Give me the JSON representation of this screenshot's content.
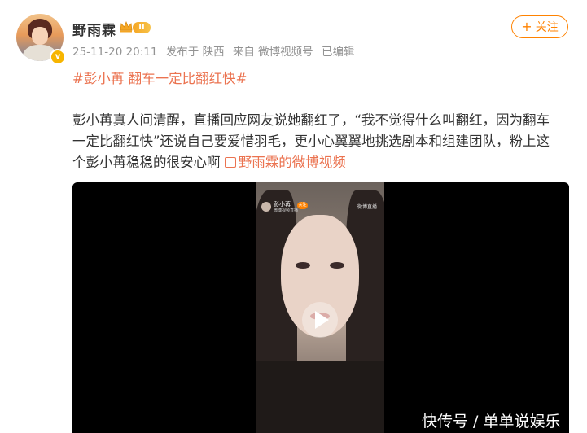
{
  "user": {
    "name": "野雨霖",
    "level_badge": "II",
    "verified_icon": "v-icon"
  },
  "meta": {
    "timestamp": "25-11-20 20:11",
    "posted_from": "发布于 陕西",
    "source": "来自 微博视频号",
    "edited": "已编辑"
  },
  "follow_button": {
    "plus": "+",
    "label": "关注"
  },
  "post": {
    "topic": "#彭小苒 翻车一定比翻红快#",
    "line1": "彭小苒真人间清醒，直播回应网友说她翻红了，“我不觉得什么叫翻红，因为翻车",
    "line2": "一定比翻红快”还说自己要爱惜羽毛，更小心翼翼地挑选剧本和组建团队，粉上这",
    "line3": "个彭小苒稳稳的很安心啊 ",
    "video_link": "野雨霖的微博视频"
  },
  "video": {
    "overlay_name": "彭小苒",
    "overlay_sub": "微博视频直播",
    "overlay_follow": "关注",
    "overlay_watermark": "微博直播",
    "watermark": "快传号 / 单单说娱乐"
  },
  "colors": {
    "accent": "#ff8200",
    "link": "#eb7350",
    "meta_gray": "#939393",
    "video_bg": "#000000"
  }
}
